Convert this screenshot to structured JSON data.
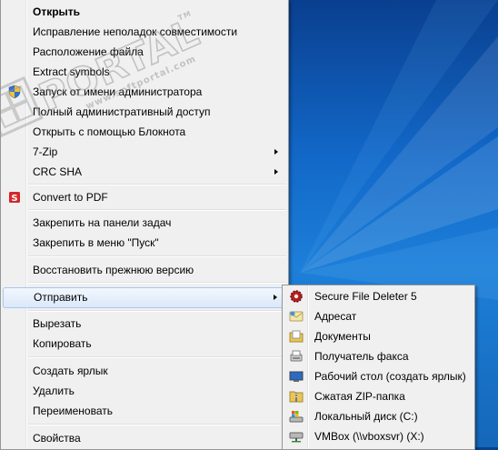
{
  "main_menu": {
    "items": [
      {
        "label": "Открыть",
        "bold": true
      },
      {
        "label": "Исправление неполадок совместимости"
      },
      {
        "label": "Расположение файла"
      },
      {
        "label": "Extract symbols"
      },
      {
        "label": "Запуск от имени администратора",
        "icon": "uac-shield-icon"
      },
      {
        "label": "Полный административный доступ"
      },
      {
        "label": "Открыть с помощью Блокнота"
      },
      {
        "label": "7-Zip",
        "submenu": true
      },
      {
        "label": "CRC SHA",
        "submenu": true
      },
      {
        "label": "Convert to PDF",
        "icon": "pdf-convert-icon"
      },
      {
        "label": "Закрепить на панели задач"
      },
      {
        "label": "Закрепить в меню \"Пуск\""
      },
      {
        "label": "Восстановить прежнюю версию"
      },
      {
        "label": "Отправить",
        "submenu": true,
        "highlighted": true
      },
      {
        "label": "Вырезать"
      },
      {
        "label": "Копировать"
      },
      {
        "label": "Создать ярлык"
      },
      {
        "label": "Удалить"
      },
      {
        "label": "Переименовать"
      },
      {
        "label": "Свойства"
      }
    ]
  },
  "send_to_menu": {
    "items": [
      {
        "label": "Secure File Deleter 5",
        "icon": "gear-icon"
      },
      {
        "label": "Адресат",
        "icon": "mail-recipient-icon"
      },
      {
        "label": "Документы",
        "icon": "documents-library-icon"
      },
      {
        "label": "Получатель факса",
        "icon": "fax-icon"
      },
      {
        "label": "Рабочий стол (создать ярлык)",
        "icon": "desktop-icon"
      },
      {
        "label": "Сжатая ZIP-папка",
        "icon": "zip-folder-icon"
      },
      {
        "label": "Локальный диск (C:)",
        "icon": "local-disk-icon"
      },
      {
        "label": "VMBox (\\\\vboxsvr) (X:)",
        "icon": "network-drive-icon"
      }
    ]
  },
  "watermark": {
    "text": "PORTAL",
    "small_text": "www.softportal.com",
    "tm": "TM"
  },
  "colors": {
    "menu_bg": "#f0f0f0",
    "highlight": "#dbe8f9",
    "highlight_border": "#a8c8ec",
    "desktop": "#1268c8"
  }
}
